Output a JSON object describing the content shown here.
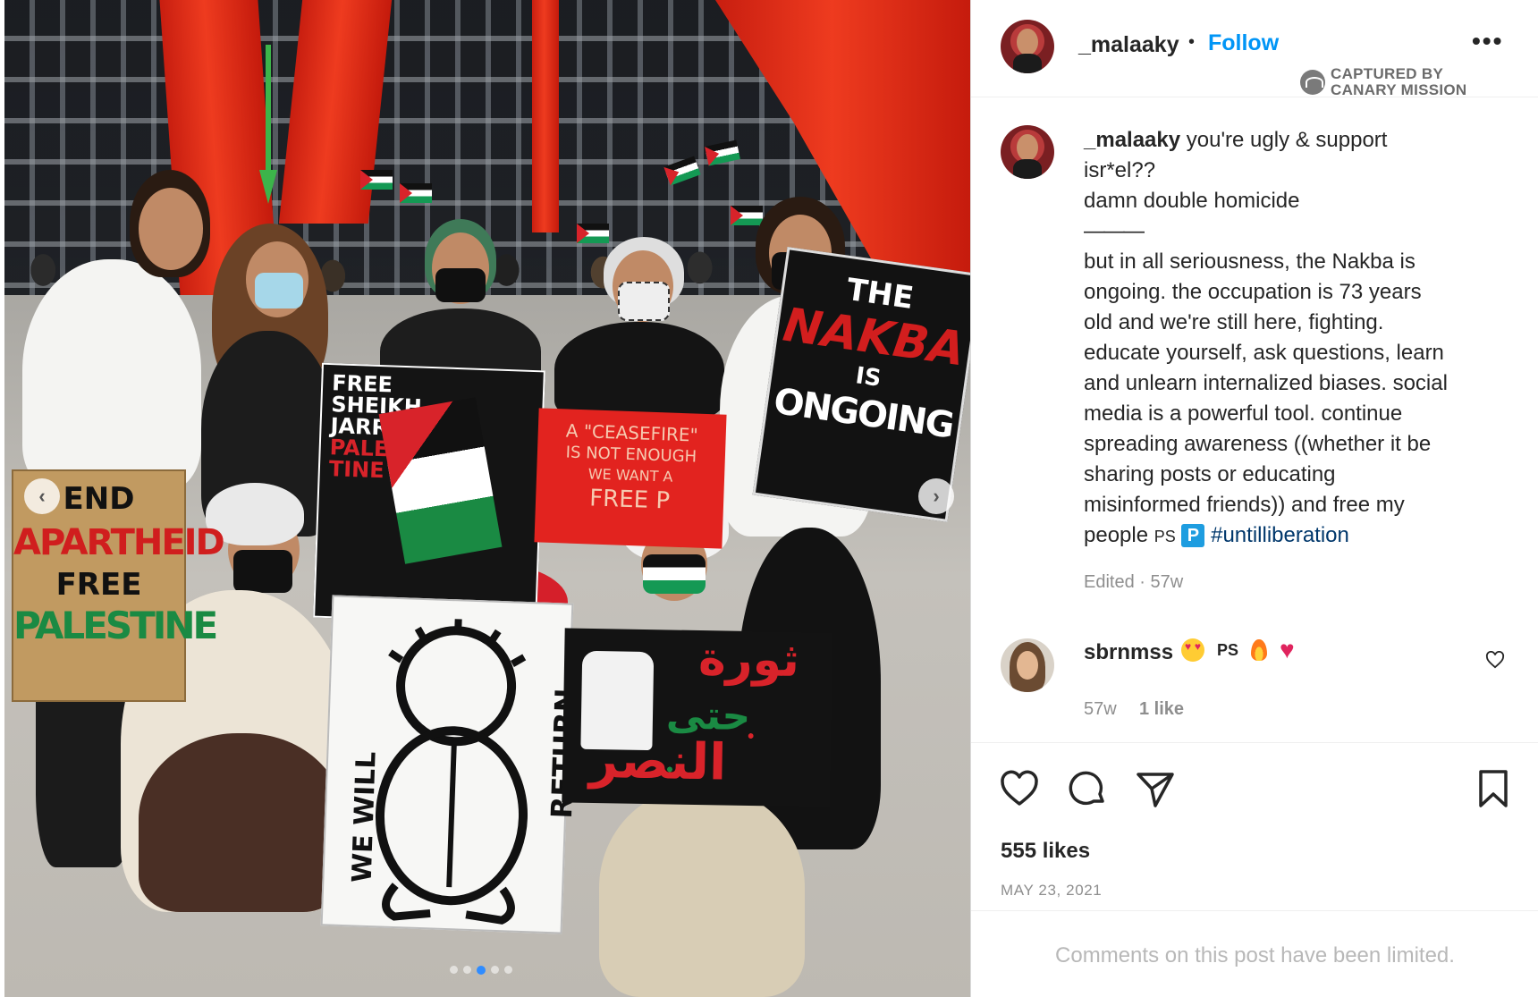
{
  "photo": {
    "signs": {
      "end_apartheid": [
        "END",
        "APARTHEID",
        "FREE",
        "PALESTINE"
      ],
      "nakba": [
        "THE",
        "NAKBA",
        "IS",
        "ONGOING"
      ],
      "free_sheikh": [
        "FREE",
        "SHEIKH",
        "JARRAH",
        "PALES",
        "TINE"
      ],
      "free_palestine_side": [
        "FREE PALESTINE"
      ],
      "ceasefire": [
        "A \"CEASEFIRE\"",
        "IS NOT ENOUGH",
        "WE WANT A",
        "FREE P"
      ],
      "return": [
        "WE WILL",
        "RETURN"
      ],
      "arabic_revolution": [
        "ثورة",
        "حتى",
        "النصر"
      ]
    },
    "carousel": {
      "total": 5,
      "active_index": 2
    }
  },
  "post": {
    "author": "_malaaky",
    "follow_label": "Follow",
    "more_label": "•••",
    "watermark": [
      "CAPTURED BY",
      "CANARY MISSION"
    ],
    "caption_lines": [
      {
        "uname": "_malaaky",
        "text": " you're ugly & support"
      },
      {
        "text": "isr*el??"
      },
      {
        "text": "damn double homicide"
      },
      {
        "text": "———"
      },
      {
        "text": "but in all seriousness, the Nakba is"
      },
      {
        "text": "ongoing. the occupation is 73 years"
      },
      {
        "text": "old and we're still here, fighting."
      },
      {
        "text": "educate yourself, ask questions, learn"
      },
      {
        "text": "and unlearn internalized biases. social"
      },
      {
        "text": "media is a powerful tool. continue"
      },
      {
        "text": "spreading awareness ((whether it be"
      },
      {
        "text": "sharing posts or educating"
      },
      {
        "text": "misinformed friends)) and free my"
      }
    ],
    "caption_last": {
      "prefix": "people ",
      "ps": "PS",
      "badge": "P",
      "hashtag": "#untilliberation"
    },
    "caption_meta": "Edited · 57w",
    "comment": {
      "user": "sbrnmss",
      "ps": "PS",
      "time": "57w",
      "likes": "1 like"
    },
    "likes": "555 likes",
    "date": "MAY 23, 2021",
    "comments_limited": "Comments on this post have been limited."
  },
  "colors": {
    "follow_blue": "#0095f6",
    "sculpture_red": "#e8361c",
    "palestine_green": "#149954",
    "palestine_red": "#d8232a"
  },
  "icons": [
    "like-icon",
    "comment-icon",
    "share-icon",
    "save-icon",
    "more-icon",
    "carousel-prev-icon",
    "carousel-next-icon",
    "canary-logo-icon"
  ]
}
